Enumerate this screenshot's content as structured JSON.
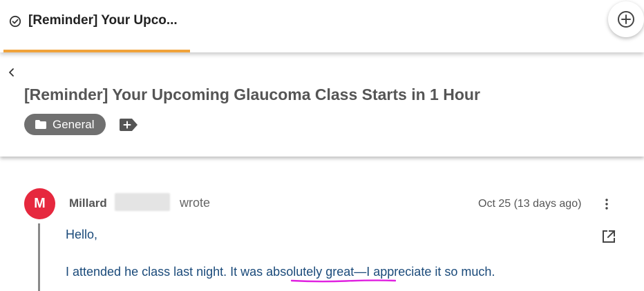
{
  "tab": {
    "title": "[Reminder] Your Upco...",
    "icon": "check-circle-icon",
    "underline_color": "#f0a23a"
  },
  "add_tab": {
    "icon": "plus-circle-icon"
  },
  "header": {
    "back_icon": "chevron-left-icon",
    "subject": "[Reminder] Your Upcoming Glaucoma Class Starts in 1 Hour",
    "category": {
      "label": "General",
      "icon": "folder-icon"
    },
    "add_tag_icon": "tag-plus-icon"
  },
  "post": {
    "avatar_letter": "M",
    "avatar_color": "#e6283e",
    "author_first": "Millard",
    "wrote_label": "wrote",
    "date": "Oct 25 (13 days ago)",
    "more_icon": "more-vertical-icon",
    "open_icon": "open-external-icon",
    "body": {
      "greeting": "Hello,",
      "line_prefix": "I attended he class last night.  It was ",
      "line_highlight": "absolutely great",
      "line_suffix": "—I appreciate it so much."
    },
    "highlight_color": "#e020e0",
    "text_color": "#1a4a7a"
  }
}
